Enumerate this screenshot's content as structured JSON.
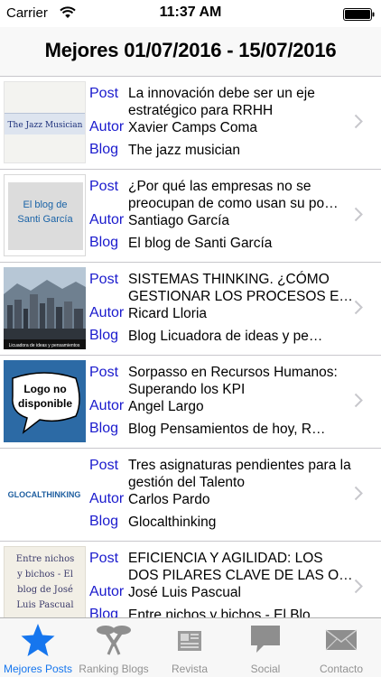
{
  "status_bar": {
    "carrier": "Carrier",
    "time": "11:37 AM"
  },
  "nav": {
    "title": "Mejores 01/07/2016 - 15/07/2016"
  },
  "field_labels": {
    "post": "Post",
    "author": "Autor",
    "blog": "Blog"
  },
  "posts": [
    {
      "post": "La innovación debe ser un eje estratégico para RRHH",
      "author": "Xavier Camps Coma",
      "blog": "The jazz musician",
      "thumb_text": "The Jazz Musician"
    },
    {
      "post": "¿Por qué las empresas no se preocupan de como usan su po…",
      "author": "Santiago García",
      "blog": "El blog de Santi García",
      "thumb_text": "El blog de Santi García"
    },
    {
      "post": "SISTEMAS THINKING. ¿CÓMO GESTIONAR LOS PROCESOS E…",
      "author": "Ricard Lloria",
      "blog": "Blog Licuadora de ideas y pe…",
      "thumb_text": "Licuadora de ideas y pensamientos"
    },
    {
      "post": "Sorpasso en Recursos Humanos: Superando los KPI",
      "author": "Angel Largo",
      "blog": "Blog Pensamientos de hoy, R…",
      "thumb_text": "Logo no disponible"
    },
    {
      "post": "Tres asignaturas pendientes para la gestión del Talento",
      "author": "Carlos Pardo",
      "blog": "Glocalthinking",
      "thumb_text": "GLOCALTHINKING"
    },
    {
      "post": "EFICIENCIA Y AGILIDAD: LOS DOS PILARES CLAVE DE LAS O…",
      "author": "José Luis Pascual",
      "blog": "Entre nichos y bichos - El Blo…",
      "thumb_text": "Entre nichos y bichos - El blog de José Luis Pascual"
    }
  ],
  "tabs": [
    {
      "label": "Mejores Posts",
      "icon": "star-icon",
      "active": true
    },
    {
      "label": "Ranking Blogs",
      "icon": "medal-icon",
      "active": false
    },
    {
      "label": "Revista",
      "icon": "newspaper-icon",
      "active": false
    },
    {
      "label": "Social",
      "icon": "speech-bubble-icon",
      "active": false
    },
    {
      "label": "Contacto",
      "icon": "envelope-icon",
      "active": false
    }
  ],
  "colors": {
    "accent": "#1676ee",
    "label_blue": "#1a1acd",
    "inactive": "#929292",
    "separator": "#c8c7cc"
  }
}
